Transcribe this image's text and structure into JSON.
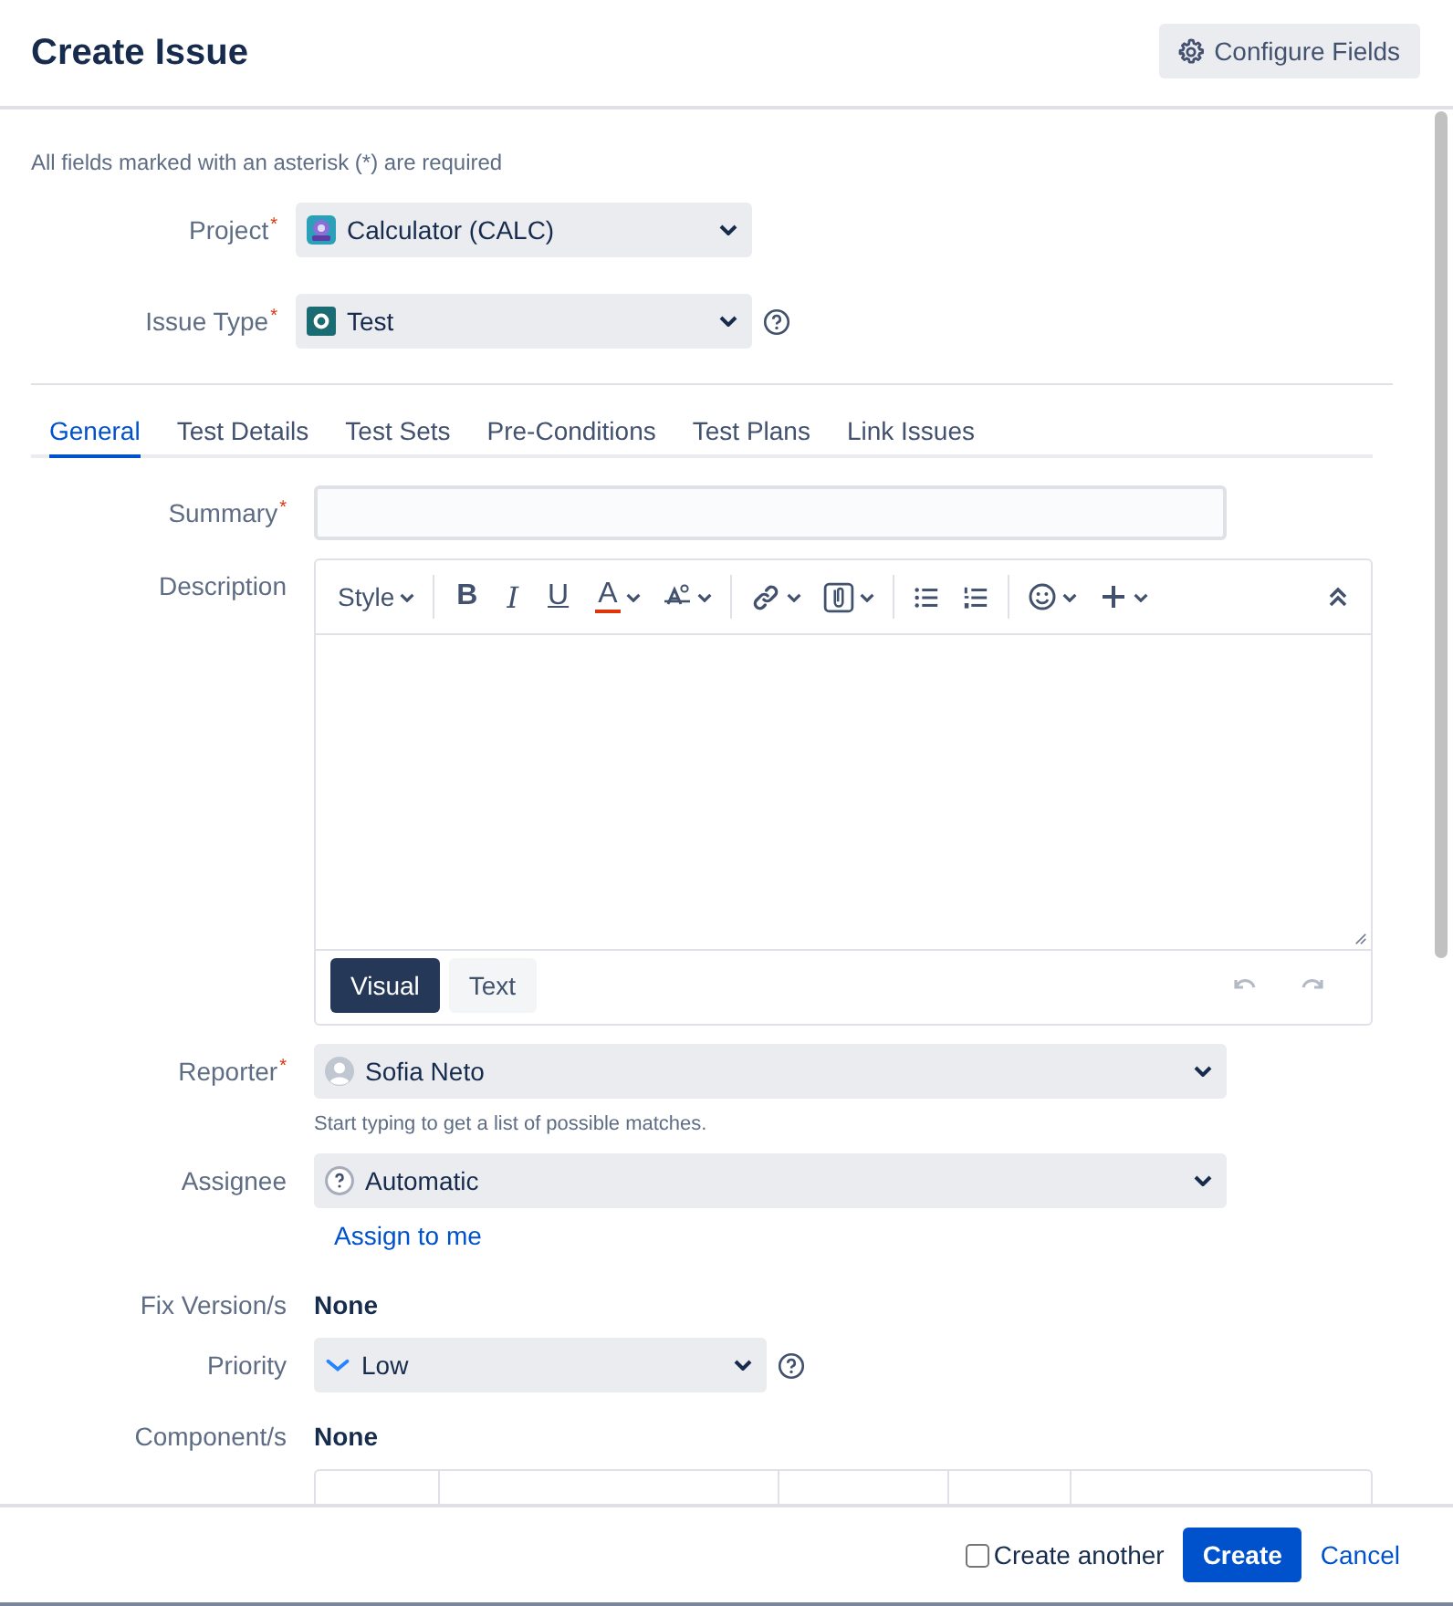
{
  "window": {
    "title": "Create Issue"
  },
  "configure_button": {
    "label": "Configure Fields"
  },
  "required_note": "All fields marked with an asterisk (*) are required",
  "top_fields": [
    {
      "label": "Project",
      "required_mark": "*",
      "value": "Calculator (CALC)",
      "help": false
    },
    {
      "label": "Issue Type",
      "required_mark": "*",
      "value": "Test",
      "help": true
    }
  ],
  "tabs": [
    {
      "label": "General",
      "selected": true
    },
    {
      "label": "Test Details",
      "selected": false
    },
    {
      "label": "Test Sets",
      "selected": false
    },
    {
      "label": "Pre-Conditions",
      "selected": false
    },
    {
      "label": "Test Plans",
      "selected": false
    },
    {
      "label": "Link Issues",
      "selected": false
    }
  ],
  "summary": {
    "label": "Summary",
    "required_mark": "*"
  },
  "description": {
    "label": "Description",
    "toolbar": [
      {
        "kind": "style",
        "label": "Style",
        "group_end": true
      },
      {
        "kind": "bold",
        "label": "B"
      },
      {
        "kind": "italic",
        "label": "I"
      },
      {
        "kind": "underline",
        "label": "U"
      },
      {
        "kind": "color",
        "label": "A"
      },
      {
        "kind": "format",
        "group_end": true
      },
      {
        "kind": "link"
      },
      {
        "kind": "attach",
        "group_end": true
      },
      {
        "kind": "bullets"
      },
      {
        "kind": "numbers",
        "group_end": true
      },
      {
        "kind": "emoji"
      },
      {
        "kind": "plus"
      },
      {
        "kind": "collapse"
      }
    ],
    "modes": [
      {
        "label": "Visual",
        "selected": true
      },
      {
        "label": "Text",
        "selected": false
      }
    ]
  },
  "reporter": {
    "label": "Reporter",
    "required_mark": "*",
    "value": "Sofia Neto",
    "hint": "Start typing to get a list of possible matches."
  },
  "assignee": {
    "label": "Assignee",
    "value": "Automatic",
    "link": "Assign to me"
  },
  "fix_version": {
    "label": "Fix Version/s",
    "value": "None"
  },
  "priority": {
    "label": "Priority",
    "value": "Low"
  },
  "component": {
    "label": "Component/s",
    "value": "None"
  },
  "footer": {
    "create_another": {
      "label": "Create another",
      "checked": false
    },
    "create_button": "Create",
    "cancel_link": "Cancel"
  }
}
